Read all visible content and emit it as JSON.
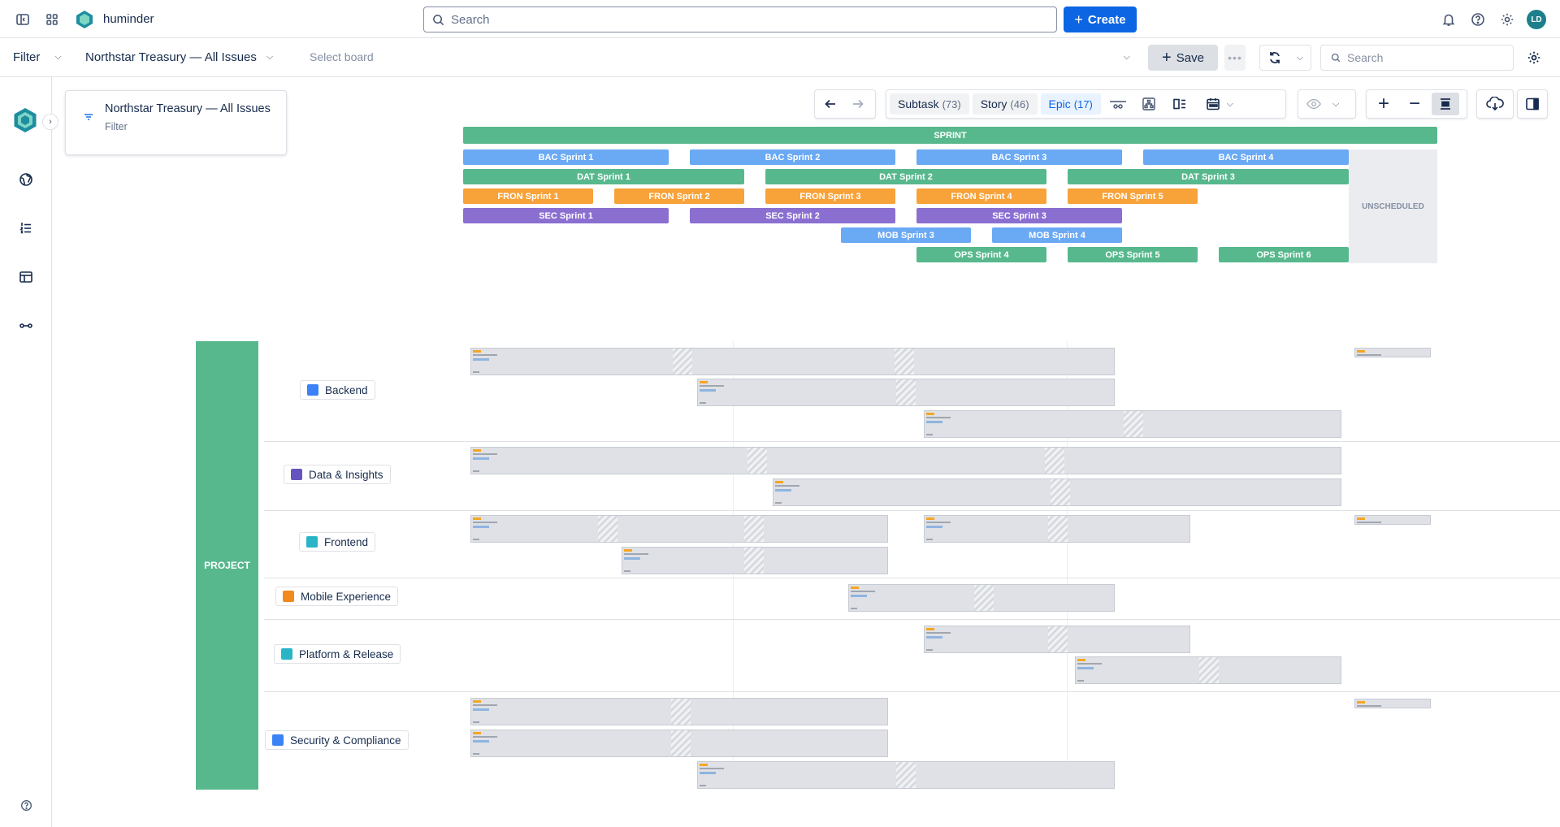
{
  "app": {
    "workspace_name": "huminder",
    "avatar_initials": "LD",
    "brand_color": "#0c66e4"
  },
  "topbar": {
    "search_placeholder": "Search",
    "create_label": "Create"
  },
  "filterbar": {
    "filter_label": "Filter",
    "filter_value": "Northstar Treasury — All Issues",
    "board_placeholder": "Select board",
    "save_label": "Save",
    "search_placeholder": "Search"
  },
  "context": {
    "title": "Northstar Treasury — All Issues",
    "subtitle": "Filter"
  },
  "toolbar": {
    "tabs": [
      {
        "label": "Subtask",
        "count": "(73)"
      },
      {
        "label": "Story",
        "count": "(46)"
      },
      {
        "label": "Epic",
        "count": "(17)"
      }
    ]
  },
  "timeline": {
    "sprint_header": "SPRINT",
    "unscheduled": "UNSCHEDULED",
    "project_header": "PROJECT",
    "sprints": [
      {
        "label": "BAC Sprint 1",
        "color": "#6aa9f4"
      },
      {
        "label": "BAC Sprint 2",
        "color": "#6aa9f4"
      },
      {
        "label": "BAC Sprint 3",
        "color": "#6aa9f4"
      },
      {
        "label": "BAC Sprint 4",
        "color": "#6aa9f4"
      },
      {
        "label": "DAT Sprint 1",
        "color": "#57b88d"
      },
      {
        "label": "DAT Sprint 2",
        "color": "#57b88d"
      },
      {
        "label": "DAT Sprint 3",
        "color": "#57b88d"
      },
      {
        "label": "FRON Sprint 1",
        "color": "#f8a23a"
      },
      {
        "label": "FRON Sprint 2",
        "color": "#f8a23a"
      },
      {
        "label": "FRON Sprint 3",
        "color": "#f8a23a"
      },
      {
        "label": "FRON Sprint 4",
        "color": "#f8a23a"
      },
      {
        "label": "FRON Sprint 5",
        "color": "#f8a23a"
      },
      {
        "label": "SEC Sprint 1",
        "color": "#8a6fd1"
      },
      {
        "label": "SEC Sprint 2",
        "color": "#8a6fd1"
      },
      {
        "label": "SEC Sprint 3",
        "color": "#8a6fd1"
      },
      {
        "label": "MOB Sprint 3",
        "color": "#6aa9f4"
      },
      {
        "label": "MOB Sprint 4",
        "color": "#6aa9f4"
      },
      {
        "label": "OPS Sprint 4",
        "color": "#57b88d"
      },
      {
        "label": "OPS Sprint 5",
        "color": "#57b88d"
      },
      {
        "label": "OPS Sprint 6",
        "color": "#57b88d"
      }
    ],
    "projects": [
      {
        "label": "Backend",
        "icon_color": "#3b82f6"
      },
      {
        "label": "Data & Insights",
        "icon_color": "#6554c0"
      },
      {
        "label": "Frontend",
        "icon_color": "#2ab5c7"
      },
      {
        "label": "Mobile Experience",
        "icon_color": "#f28a1d"
      },
      {
        "label": "Platform & Release",
        "icon_color": "#2ab5c7"
      },
      {
        "label": "Security & Compliance",
        "icon_color": "#3b82f6"
      }
    ]
  }
}
